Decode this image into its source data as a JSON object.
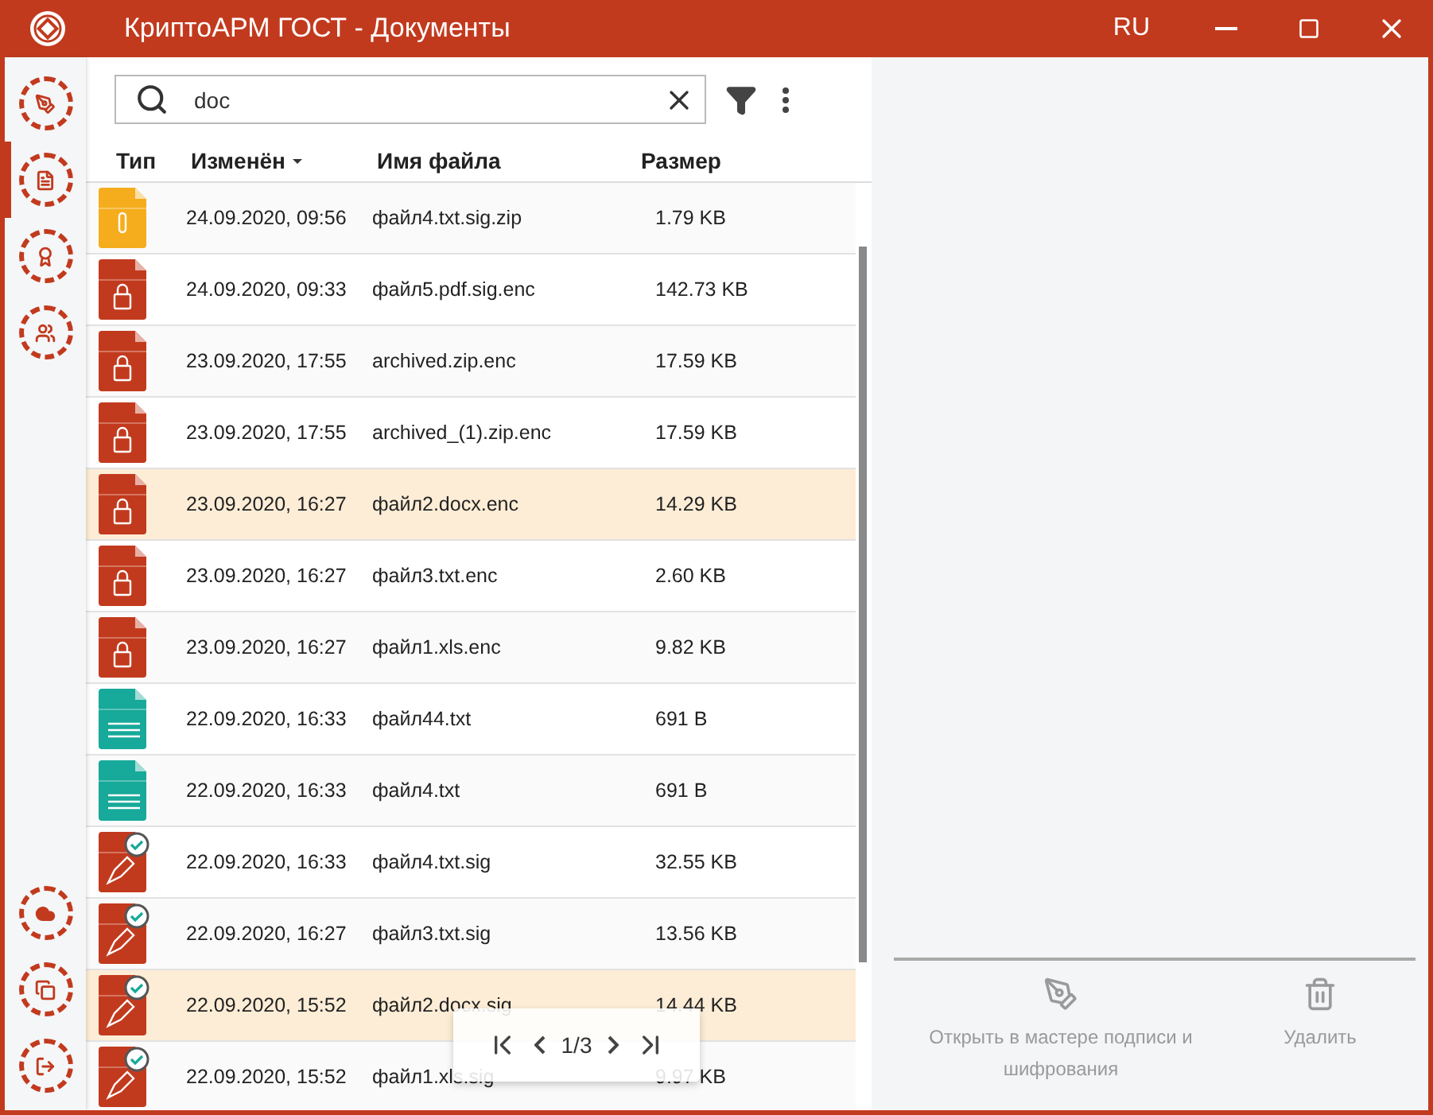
{
  "window": {
    "title": "КриптоАРМ ГОСТ - Документы",
    "language": "RU"
  },
  "sidebar": {
    "items": [
      {
        "kind": "sign",
        "selected": false
      },
      {
        "kind": "documents",
        "selected": true
      },
      {
        "kind": "certificates",
        "selected": false
      },
      {
        "kind": "contacts",
        "selected": false
      }
    ],
    "bottom_items": [
      {
        "kind": "cloud"
      },
      {
        "kind": "windows"
      },
      {
        "kind": "exit"
      }
    ]
  },
  "search": {
    "value": "doc"
  },
  "table": {
    "columns": [
      "Тип",
      "Изменён",
      "Имя файла",
      "Размер"
    ],
    "rows": [
      {
        "kind": "zip",
        "modified": "24.09.2020, 09:56",
        "name": "файл4.txt.sig.zip",
        "size": "1.79 KB",
        "selected": false
      },
      {
        "kind": "enc",
        "modified": "24.09.2020, 09:33",
        "name": "файл5.pdf.sig.enc",
        "size": "142.73 KB",
        "selected": false
      },
      {
        "kind": "enc",
        "modified": "23.09.2020, 17:55",
        "name": "archived.zip.enc",
        "size": "17.59 KB",
        "selected": false
      },
      {
        "kind": "enc",
        "modified": "23.09.2020, 17:55",
        "name": "archived_(1).zip.enc",
        "size": "17.59 KB",
        "selected": false
      },
      {
        "kind": "enc",
        "modified": "23.09.2020, 16:27",
        "name": "файл2.docx.enc",
        "size": "14.29 KB",
        "selected": true
      },
      {
        "kind": "enc",
        "modified": "23.09.2020, 16:27",
        "name": "файл3.txt.enc",
        "size": "2.60 KB",
        "selected": false
      },
      {
        "kind": "enc",
        "modified": "23.09.2020, 16:27",
        "name": "файл1.xls.enc",
        "size": "9.82 KB",
        "selected": false
      },
      {
        "kind": "txt",
        "modified": "22.09.2020, 16:33",
        "name": "файл44.txt",
        "size": "691 B",
        "selected": false
      },
      {
        "kind": "txt",
        "modified": "22.09.2020, 16:33",
        "name": "файл4.txt",
        "size": "691 B",
        "selected": false
      },
      {
        "kind": "sig",
        "modified": "22.09.2020, 16:33",
        "name": "файл4.txt.sig",
        "size": "32.55 KB",
        "selected": false
      },
      {
        "kind": "sig",
        "modified": "22.09.2020, 16:27",
        "name": "файл3.txt.sig",
        "size": "13.56 KB",
        "selected": false
      },
      {
        "kind": "sig",
        "modified": "22.09.2020, 15:52",
        "name": "файл2.docx.sig",
        "size": "14.44 KB",
        "selected": true
      },
      {
        "kind": "sig",
        "modified": "22.09.2020, 15:52",
        "name": "файл1.xls.sig",
        "size": "9.97 KB",
        "selected": false
      }
    ]
  },
  "pager": {
    "page": "1/3"
  },
  "actions": [
    {
      "kind": "wizard",
      "label": "Открыть в мастере подписи и шифрования",
      "disabled": true
    },
    {
      "kind": "delete",
      "label": "Удалить",
      "disabled": true
    }
  ]
}
